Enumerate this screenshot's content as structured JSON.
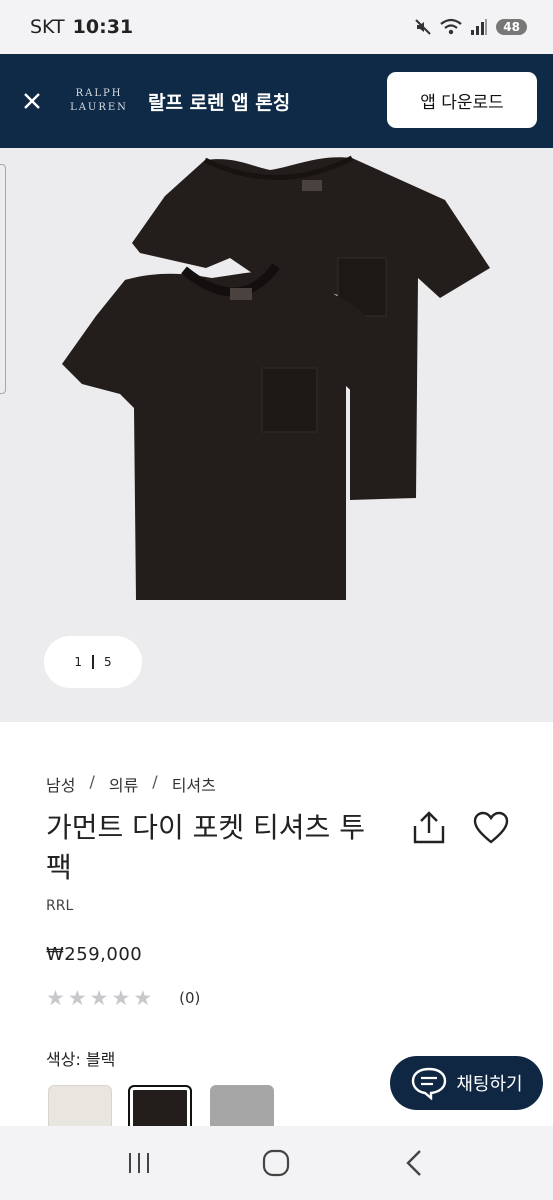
{
  "status_bar": {
    "carrier": "SKT",
    "time": "10:31",
    "battery": "48",
    "icons": [
      "mute-icon",
      "wifi-icon",
      "signal-icon",
      "battery-icon"
    ]
  },
  "app_banner": {
    "logo_line1": "RALPH",
    "logo_line2": "LAUREN",
    "title": "랄프 로렌 앱 론칭",
    "download_label": "앱 다운로드"
  },
  "gallery": {
    "current_page": "1",
    "total_pages": "5"
  },
  "product": {
    "breadcrumb": [
      "남성",
      "의류",
      "티셔츠"
    ],
    "breadcrumb_separator": "/",
    "title": "가먼트 다이 포켓 티셔츠 투팩",
    "brand": "RRL",
    "price": "₩259,000",
    "rating_stars": 0,
    "rating_max": 5,
    "review_count": "(0)",
    "color_label": "색상: 블랙",
    "swatches": [
      {
        "name": "cream",
        "color": "#e9e6e0",
        "selected": false
      },
      {
        "name": "black",
        "color": "#231e1c",
        "selected": true
      },
      {
        "name": "grey",
        "color": "#a6a6a6",
        "selected": false
      }
    ]
  },
  "chat": {
    "label": "채팅하기"
  },
  "colors": {
    "banner_bg": "#0e2a47",
    "chat_bg": "#102744",
    "gallery_bg": "#ecebee",
    "shirt": "#231e1c"
  }
}
